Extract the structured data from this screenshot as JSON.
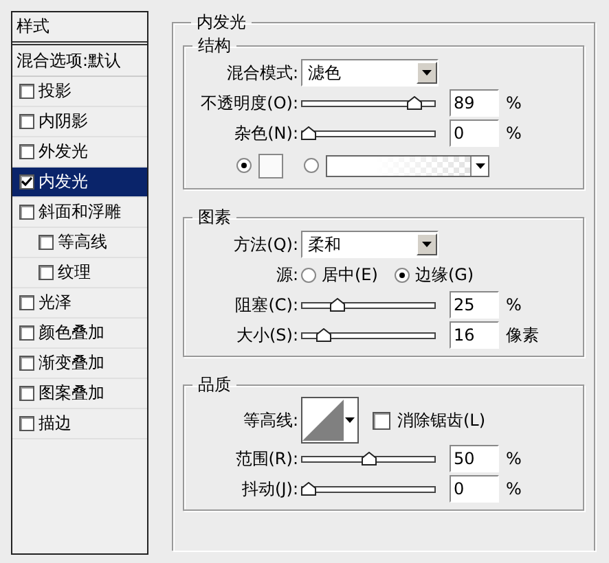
{
  "sidebar": {
    "title": "样式",
    "header": "混合选项:默认",
    "items": [
      {
        "label": "投影",
        "checked": false,
        "selected": false
      },
      {
        "label": "内阴影",
        "checked": false,
        "selected": false
      },
      {
        "label": "外发光",
        "checked": false,
        "selected": false
      },
      {
        "label": "内发光",
        "checked": true,
        "selected": true
      },
      {
        "label": "斜面和浮雕",
        "checked": false,
        "selected": false,
        "children": [
          {
            "label": "等高线",
            "checked": false,
            "selected": false
          },
          {
            "label": "纹理",
            "checked": false,
            "selected": false
          }
        ]
      },
      {
        "label": "光泽",
        "checked": false,
        "selected": false
      },
      {
        "label": "颜色叠加",
        "checked": false,
        "selected": false
      },
      {
        "label": "渐变叠加",
        "checked": false,
        "selected": false
      },
      {
        "label": "图案叠加",
        "checked": false,
        "selected": false
      },
      {
        "label": "描边",
        "checked": false,
        "selected": false
      }
    ]
  },
  "panel": {
    "title": "内发光",
    "groups": [
      {
        "title": "结构",
        "rows": [
          {
            "kind": "dropdown",
            "label": "混合模式:",
            "value": "滤色"
          },
          {
            "kind": "slider",
            "label": "不透明度(O):",
            "level": 0.89,
            "value": "89",
            "unit": "%"
          },
          {
            "kind": "slider",
            "label": "杂色(N):",
            "level": 0,
            "value": "0",
            "unit": "%"
          },
          {
            "kind": "color",
            "options": [
              {
                "kind": "swatch",
                "selected": true
              },
              {
                "kind": "gradient",
                "selected": false
              }
            ]
          }
        ]
      },
      {
        "title": "图素",
        "rows": [
          {
            "kind": "dropdown",
            "label": "方法(Q):",
            "value": "柔和"
          },
          {
            "kind": "radio",
            "label": "源:",
            "options": [
              {
                "label": "居中(E)",
                "selected": false
              },
              {
                "label": "边缘(G)",
                "selected": true
              }
            ]
          },
          {
            "kind": "slider",
            "label": "阻塞(C):",
            "level": 0.24,
            "value": "25",
            "unit": "%"
          },
          {
            "kind": "slider",
            "label": "大小(S):",
            "level": 0.13,
            "value": "16",
            "unit": "像素"
          }
        ]
      },
      {
        "title": "品质",
        "rows": [
          {
            "kind": "contour",
            "label": "等高线:",
            "checkbox": {
              "label": "消除锯齿(L)",
              "checked": false
            }
          },
          {
            "kind": "slider",
            "label": "范围(R):",
            "level": 0.5,
            "value": "50",
            "unit": "%"
          },
          {
            "kind": "slider",
            "label": "抖动(J):",
            "level": 0,
            "value": "0",
            "unit": "%"
          }
        ]
      }
    ]
  }
}
